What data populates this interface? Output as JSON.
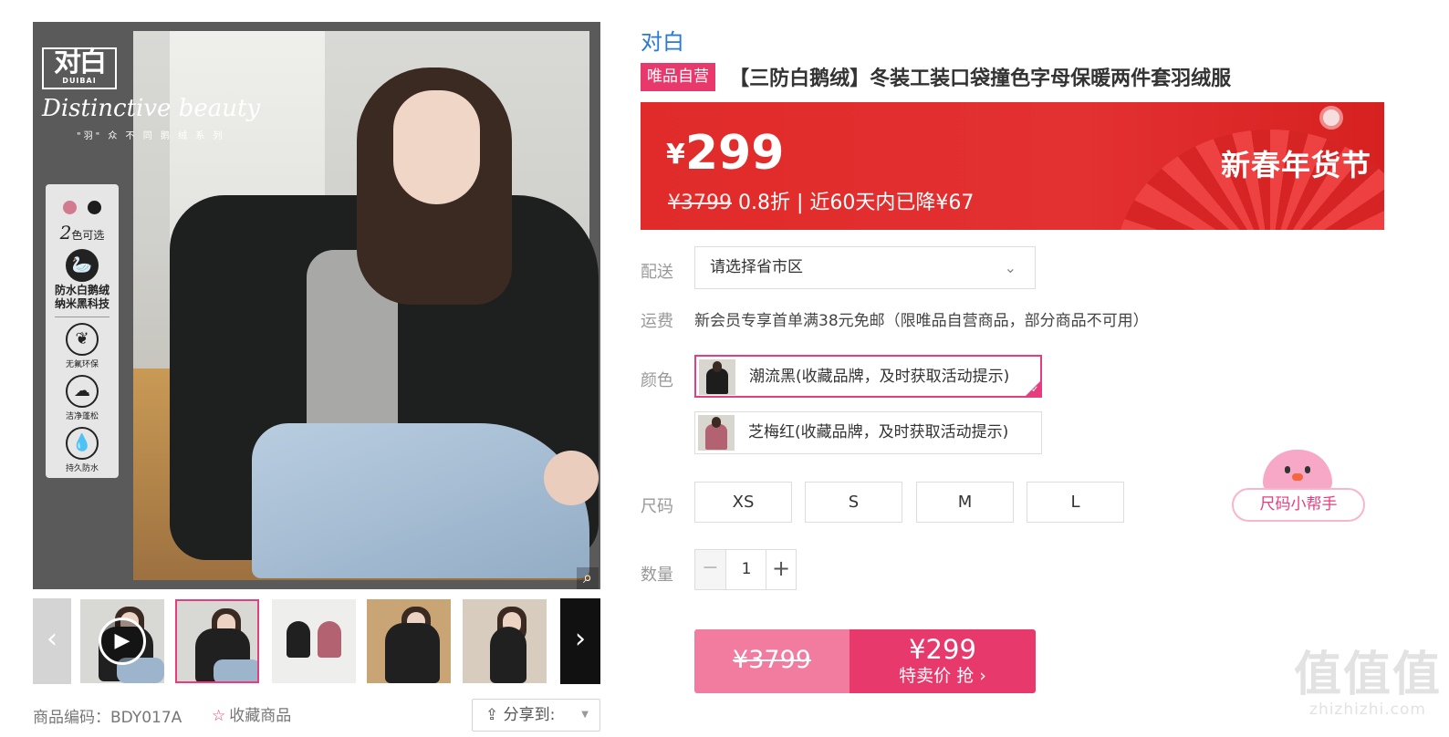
{
  "gallery": {
    "brand_logo": "对白",
    "brand_logo_sub": "DUIBAI",
    "script_text": "Distinctive beauty",
    "series_text": "\"羽\" 众 不 同   鹅 绒 系 列",
    "feature_panel": {
      "color_dots": [
        "#d27a8f",
        "#1d1d1d"
      ],
      "colors_count_num": "2",
      "colors_count_text": "色可选",
      "feature_strong_line1": "防水白鹅绒",
      "feature_strong_line2": "纳米黑科技",
      "features": [
        "无氟环保",
        "洁净蓬松",
        "持久防水"
      ]
    },
    "zoom_icon": "magnifier-icon",
    "thumbnails_count": 6,
    "active_thumbnail": 1
  },
  "bottom_bar": {
    "sku": "商品编码：BDY017A",
    "favorite_label": "收藏商品",
    "share_label": "分享到:"
  },
  "product": {
    "brand": "对白",
    "badge": "唯品自营",
    "title": "【三防白鹅绒】冬装工装口袋撞色字母保暖两件套羽绒服"
  },
  "price_banner": {
    "currency": "¥",
    "price": "299",
    "original_price": "¥3799",
    "discount_text": "0.8折 | 近60天内已降¥67",
    "festival": "新春年货节",
    "banner_color": "#e12b2b"
  },
  "delivery": {
    "label": "配送",
    "placeholder": "请选择省市区"
  },
  "shipping": {
    "label": "运费",
    "text": "新会员专享首单满38元免邮（限唯品自营商品，部分商品不可用）"
  },
  "color": {
    "label": "颜色",
    "options": [
      {
        "label": "潮流黑(收藏品牌，及时获取活动提示)",
        "selected": true
      },
      {
        "label": "芝梅红(收藏品牌，及时获取活动提示)",
        "selected": false
      }
    ]
  },
  "size": {
    "label": "尺码",
    "options": [
      "XS",
      "S",
      "M",
      "L"
    ],
    "helper": "尺码小帮手"
  },
  "quantity": {
    "label": "数量",
    "value": "1",
    "minus": "−",
    "plus": "+"
  },
  "buy_button": {
    "original": "¥3799",
    "price": "¥299",
    "action": "特卖价 抢 ›"
  },
  "watermark": {
    "main": "值值值",
    "sub": "zhizhizhi.com"
  },
  "accent_color": "#e73c7d"
}
